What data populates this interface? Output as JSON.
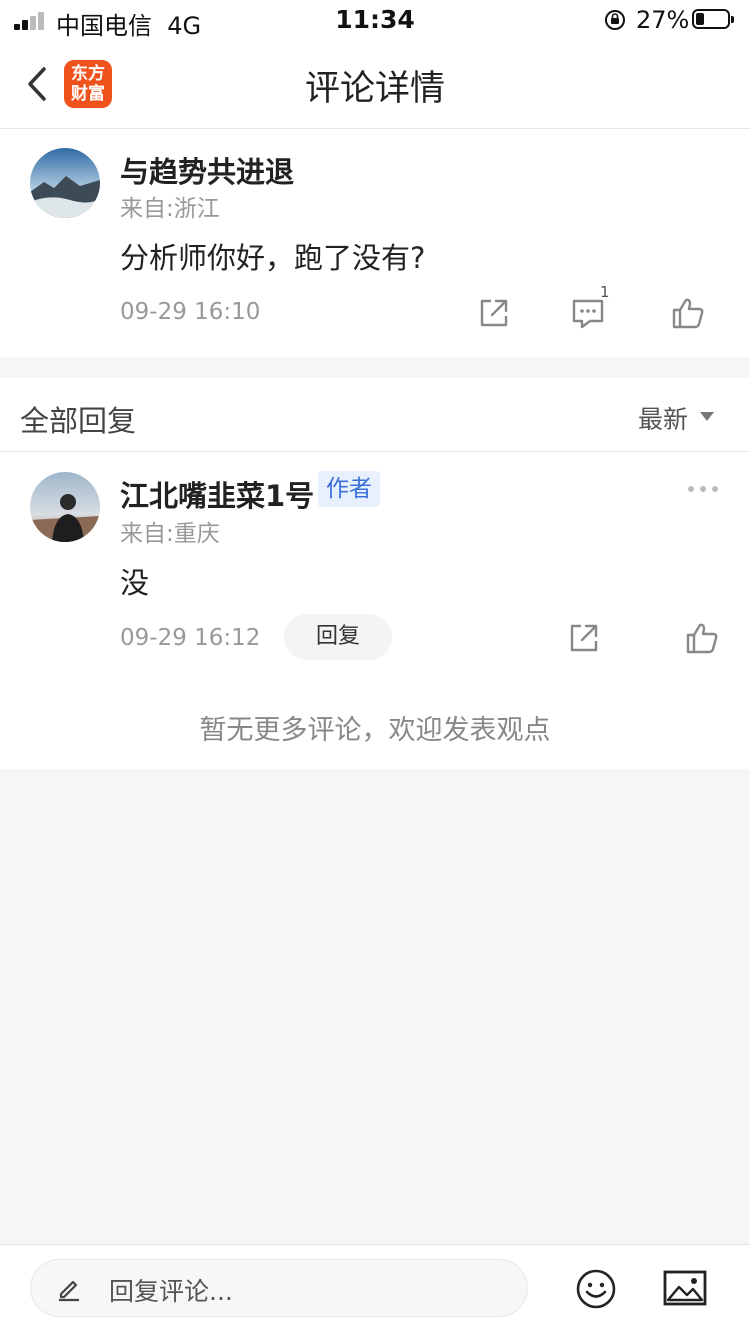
{
  "status_bar": {
    "carrier": "中国电信",
    "network": "4G",
    "time": "11:34",
    "battery_percent": "27%",
    "battery_level": 0.27,
    "signal_bars_filled": 2,
    "signal_bars_total": 4
  },
  "nav": {
    "back_icon": "chevron-left-icon",
    "logo_text": "东方财富",
    "logo_color": "#f0521c",
    "title": "评论详情"
  },
  "post": {
    "author": "与趋势共进退",
    "location": "来自:浙江",
    "text": "分析师你好，跑了没有?",
    "time": "09-29 16:10",
    "comment_count": "1",
    "actions": [
      "share-icon",
      "comment-icon",
      "thumbs-up-icon"
    ]
  },
  "replies": {
    "header": "全部回复",
    "sort": "最新",
    "items": [
      {
        "author": "江北嘴韭菜1号",
        "badge": "作者",
        "location": "来自:重庆",
        "text": "没",
        "time": "09-29 16:12",
        "reply_label": "回复"
      }
    ],
    "empty_hint": "暂无更多评论，欢迎发表观点"
  },
  "bottom_bar": {
    "placeholder": "回复评论...",
    "icons": [
      "pen-icon",
      "emoji-icon",
      "image-icon"
    ]
  },
  "colors": {
    "accent_blue": "#3a6fd8",
    "page_bg": "#f5f6f8",
    "muted_text": "#999999"
  }
}
